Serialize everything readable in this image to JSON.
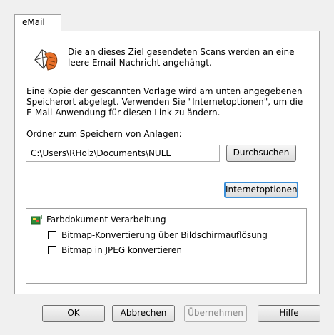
{
  "tab": {
    "label": "eMail"
  },
  "intro": {
    "text": "Die an dieses Ziel gesendeten Scans werden an eine leere Email-Nachricht angehängt."
  },
  "description": {
    "text": "Eine Kopie der gescannten Vorlage wird am unten angegebenen Speicherort abgelegt. Verwenden Sie \"Internetoptionen\", um die E-Mail-Anwendung für diesen Link zu ändern."
  },
  "folder": {
    "label": "Ordner zum Speichern von Anlagen:",
    "value": "C:\\Users\\RHolz\\Documents\\NULL",
    "browse_label": "Durchsuchen"
  },
  "internet_options_label": "Internetoptionen",
  "options": {
    "root_label": "Farbdokument-Verarbeitung",
    "items": [
      {
        "label": "Bitmap-Konvertierung über Bildschirmauflösung",
        "checked": false
      },
      {
        "label": "Bitmap in JPEG konvertieren",
        "checked": false
      }
    ]
  },
  "buttons": {
    "ok": "OK",
    "cancel": "Abbrechen",
    "apply": "Übernehmen",
    "help": "Hilfe"
  }
}
